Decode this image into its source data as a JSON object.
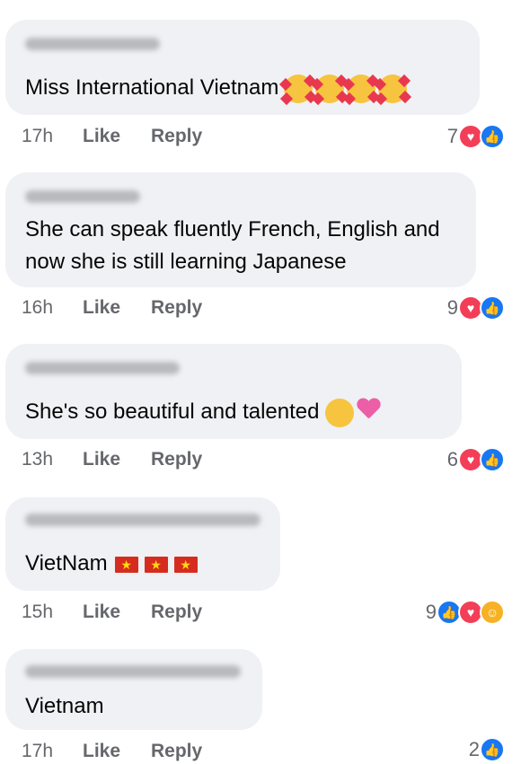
{
  "comments": [
    {
      "text": "Miss International Vietnam",
      "time": "17h",
      "like_label": "Like",
      "reply_label": "Reply",
      "reaction_count": "7",
      "emojis": [
        "smiling-face-with-hearts-emoji",
        "smiling-face-with-hearts-emoji",
        "smiling-face-with-hearts-emoji",
        "smiling-face-with-hearts-emoji"
      ],
      "reactions": [
        "love",
        "like"
      ]
    },
    {
      "text": "She can speak fluently French, English and now she is still learning Japanese",
      "time": "16h",
      "like_label": "Like",
      "reply_label": "Reply",
      "reaction_count": "9",
      "reactions": [
        "love",
        "like"
      ]
    },
    {
      "text": "She's so beautiful and talented",
      "time": "13h",
      "like_label": "Like",
      "reply_label": "Reply",
      "reaction_count": "6",
      "emojis": [
        "heart-eyes-emoji",
        "sparkling-heart-emoji"
      ],
      "reactions": [
        "love",
        "like"
      ]
    },
    {
      "text": "VietNam",
      "time": "15h",
      "like_label": "Like",
      "reply_label": "Reply",
      "reaction_count": "9",
      "emojis": [
        "vietnam-flag-emoji",
        "vietnam-flag-emoji",
        "vietnam-flag-emoji"
      ],
      "reactions": [
        "like",
        "love",
        "care"
      ]
    },
    {
      "text": "Vietnam",
      "time": "17h",
      "like_label": "Like",
      "reply_label": "Reply",
      "reaction_count": "2",
      "reactions": [
        "like"
      ]
    }
  ],
  "colors": {
    "bubble": "#eff1f4",
    "meta_text": "#65676b",
    "love": "#f33e58",
    "like": "#1877f2",
    "care": "#f7b125"
  }
}
